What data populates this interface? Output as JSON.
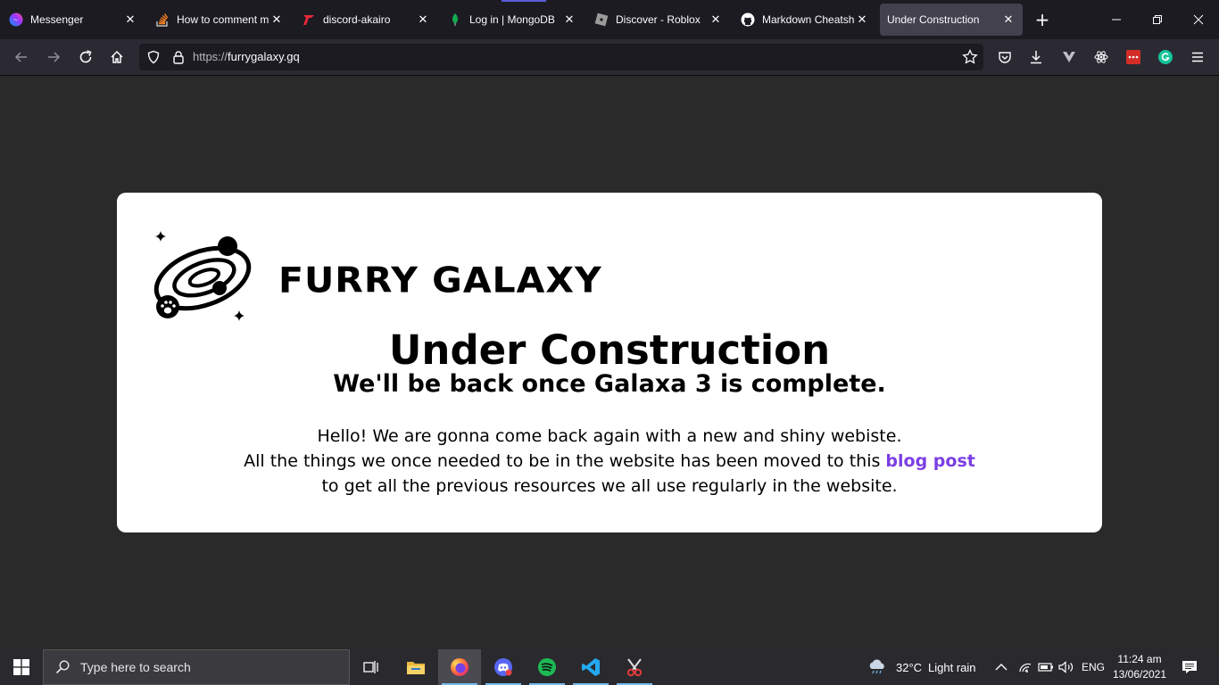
{
  "browser": {
    "tabs": [
      {
        "label": "Messenger",
        "icon": "messenger-icon"
      },
      {
        "label": "How to comment m",
        "icon": "stackoverflow-icon"
      },
      {
        "label": "discord-akairo",
        "icon": "akairo-icon"
      },
      {
        "label": "Log in | MongoDB",
        "icon": "mongodb-icon"
      },
      {
        "label": "Discover - Roblox",
        "icon": "roblox-icon"
      },
      {
        "label": "Markdown Cheatshe",
        "icon": "github-icon"
      },
      {
        "label": "Under Construction",
        "icon": "none",
        "active": true
      }
    ],
    "url_prefix": "https://",
    "url_host": "furrygalaxy.gq"
  },
  "page": {
    "logo_text": "FURRY GALAXY",
    "title": "Under Construction",
    "subtitle": "We'll be back once Galaxa 3 is complete.",
    "line1": "Hello! We are gonna come back again with a new and shiny webiste.",
    "line2_before": "All the things we once needed to be in the website has been moved to this ",
    "link_text": "blog post",
    "line3": "to get all the previous resources we all use regularly in the website.",
    "link_color": "#7b3fe4"
  },
  "taskbar": {
    "search_placeholder": "Type here to search",
    "weather_temp": "32°C",
    "weather_text": "Light rain",
    "language": "ENG",
    "time": "11:24 am",
    "date": "13/06/2021",
    "apps": [
      "task-view-icon",
      "file-explorer-icon",
      "firefox-icon",
      "discord-icon",
      "spotify-icon",
      "vscode-icon",
      "snipping-tool-icon"
    ]
  }
}
